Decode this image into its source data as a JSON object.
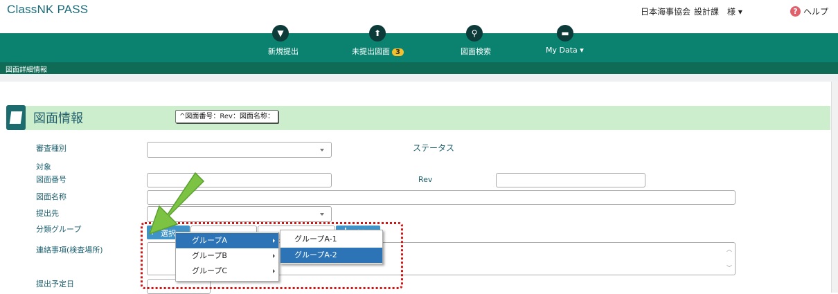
{
  "header": {
    "app_title": "ClassNK PASS",
    "org": "日本海事協会",
    "dept": "設計課",
    "user_suffix": "様 ▾",
    "help_label": "ヘルプ",
    "help_symbol": "?"
  },
  "nav": {
    "items": [
      {
        "label": "新規提出",
        "icon": "new-submission-icon"
      },
      {
        "label": "未提出図面",
        "badge": "3",
        "icon": "upload-icon"
      },
      {
        "label": "図面検索",
        "icon": "search-icon"
      },
      {
        "label": "My Data ▾",
        "icon": "folder-icon"
      }
    ]
  },
  "breadcrumb": "図面詳細情報",
  "section": {
    "title": "図面情報",
    "toggle_label": "^図面番号：Rev：図面名称："
  },
  "form": {
    "review_type_label": "審査種別",
    "status_label": "ステータス",
    "target_label": "対象",
    "drawing_number_label": "図面番号",
    "rev_label": "Rev",
    "drawing_name_label": "図面名称",
    "submit_to_label": "提出先",
    "group_label": "分類グループ",
    "contact_label": "連絡事項(検査場所)",
    "due_date_label": "提出予定日",
    "select_button_label": "選択",
    "add_button_label": "追加"
  },
  "menu": {
    "items": [
      {
        "label": "グループA",
        "selected": true
      },
      {
        "label": "グループB",
        "selected": false
      },
      {
        "label": "グループC",
        "selected": false
      }
    ],
    "submenu": [
      {
        "label": "グループA-1",
        "selected": false
      },
      {
        "label": "グループA-2",
        "selected": true
      }
    ]
  },
  "colors": {
    "nav_green": "#0b8270",
    "section_green": "#cdeecd",
    "selected_blue": "#2c74b5",
    "annotation_red": "#d01515",
    "arrow_green": "#7cc343"
  }
}
